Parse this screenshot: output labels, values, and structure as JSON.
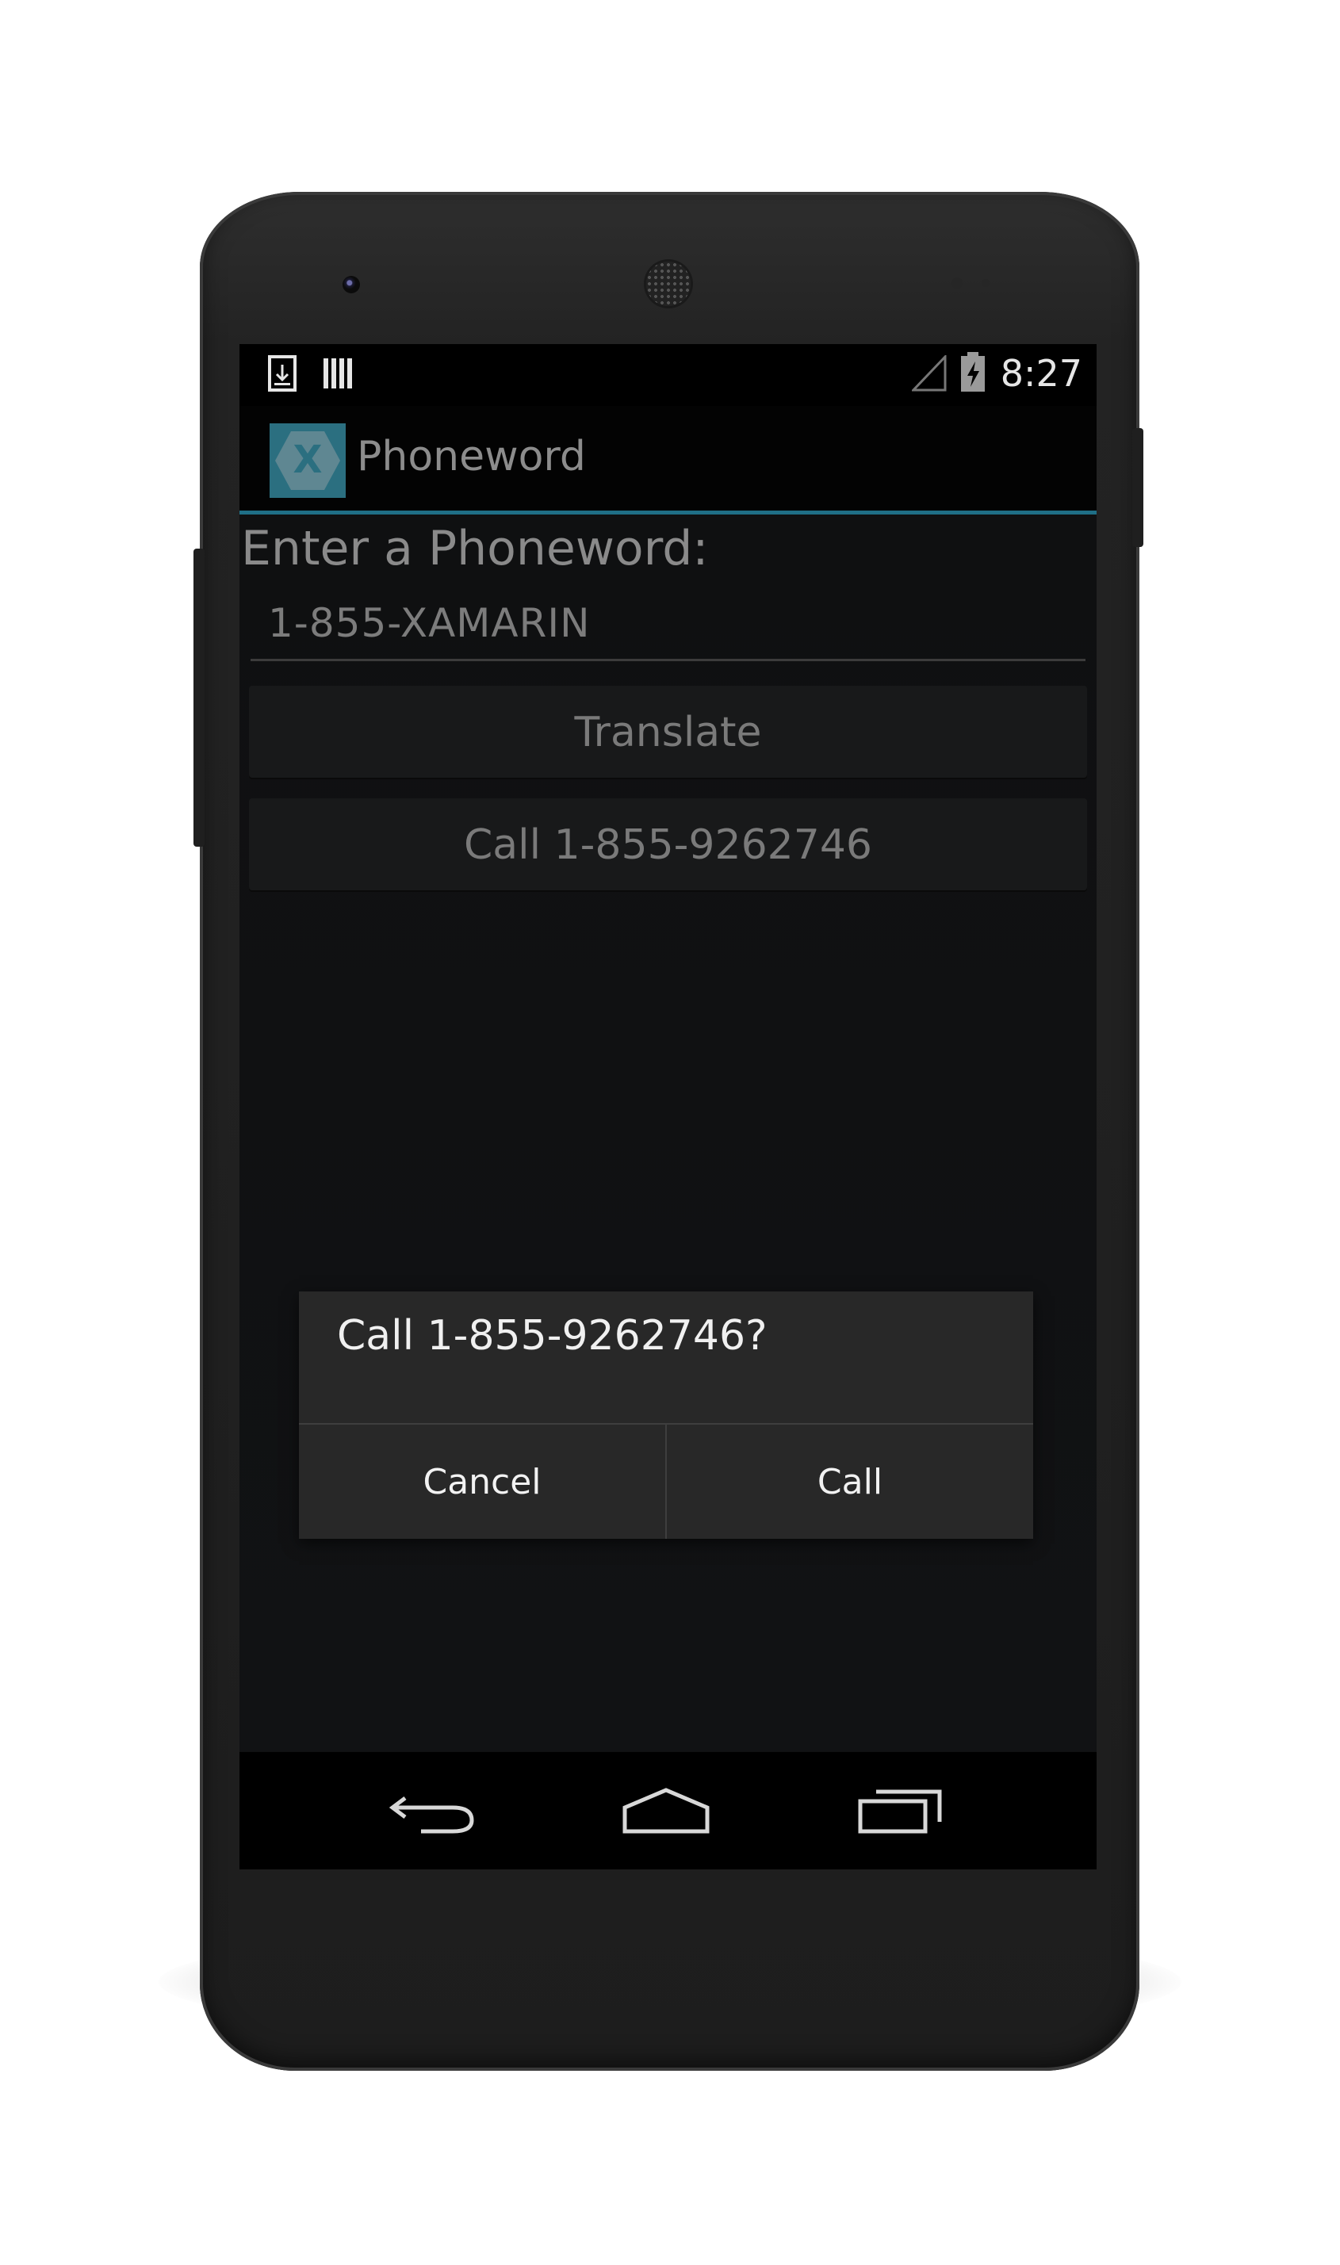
{
  "status_bar": {
    "time": "8:27"
  },
  "action_bar": {
    "title": "Phoneword",
    "logo_letter": "X"
  },
  "main": {
    "label": "Enter a Phoneword:",
    "phoneword_value": "1-855-XAMARIN",
    "translate_label": "Translate",
    "call_label": "Call 1-855-9262746"
  },
  "dialog": {
    "message": "Call 1-855-9262746?",
    "cancel_label": "Cancel",
    "call_label": "Call"
  },
  "nav": {
    "icons": [
      "back-icon",
      "home-icon",
      "recents-icon"
    ]
  },
  "colors": {
    "accent": "#1f6f86",
    "logo_bg": "#2b6f80"
  }
}
